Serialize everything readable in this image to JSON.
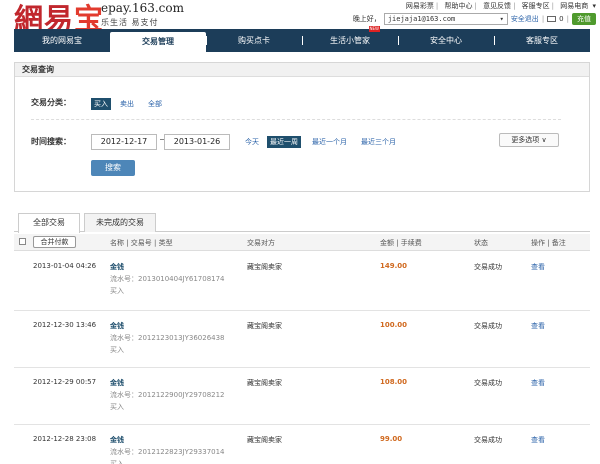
{
  "header": {
    "logo_part1": "網易",
    "logo_part2": "宝",
    "site_url": "epay.163.com",
    "tagline": "乐生活  易支付",
    "top_links": [
      "网易彩票",
      "帮助中心",
      "意见反馈",
      "客服专区",
      "网易电商"
    ],
    "greeting": "晚上好，",
    "username": "jiejaja1@163.com",
    "safe_exit": "安全退出",
    "mail_count": "0",
    "charge_label": "充值"
  },
  "nav": {
    "items": [
      {
        "label": "我的网易宝"
      },
      {
        "label": "交易管理"
      },
      {
        "label": "购买点卡"
      },
      {
        "label": "生活小管家"
      },
      {
        "label": "安全中心"
      },
      {
        "label": "客服专区"
      }
    ],
    "new_badge": "NEW"
  },
  "query": {
    "title": "交易查询",
    "category_label": "交易分类：",
    "categories": [
      "买入",
      "卖出",
      "全部"
    ],
    "time_label": "时间搜索：",
    "start_date": "2012-12-17",
    "end_date": "2013-01-26",
    "ranges": [
      "今天",
      "最近一周",
      "最近一个月",
      "最近三个月"
    ],
    "more_options": "更多选项 ∨",
    "search_button": "搜索"
  },
  "tabs": [
    "全部交易",
    "未完成的交易"
  ],
  "table": {
    "merge_pay": "合并付款",
    "headers": [
      "名称 | 交易号 | 类型",
      "交易对方",
      "金额 | 手续费",
      "状态",
      "操作 | 备注"
    ],
    "rows": [
      {
        "date": "2013-01-04 04:26",
        "name": "金钱",
        "serial": "流水号：2013010404JY61708174",
        "type": "买入",
        "party": "藏宝阁卖家",
        "amount": "149.00",
        "status": "交易成功",
        "action": "查看"
      },
      {
        "date": "2012-12-30 13:46",
        "name": "金钱",
        "serial": "流水号：2012123013JY36026438",
        "type": "买入",
        "party": "藏宝阁卖家",
        "amount": "100.00",
        "status": "交易成功",
        "action": "查看"
      },
      {
        "date": "2012-12-29 00:57",
        "name": "金钱",
        "serial": "流水号：2012122900JY29708212",
        "type": "买入",
        "party": "藏宝阁卖家",
        "amount": "108.00",
        "status": "交易成功",
        "action": "查看"
      },
      {
        "date": "2012-12-28 23:08",
        "name": "金钱",
        "serial": "流水号：2012122823JY29337014",
        "type": "买入",
        "party": "藏宝阁卖家",
        "amount": "99.00",
        "status": "交易成功",
        "action": "查看"
      }
    ]
  }
}
